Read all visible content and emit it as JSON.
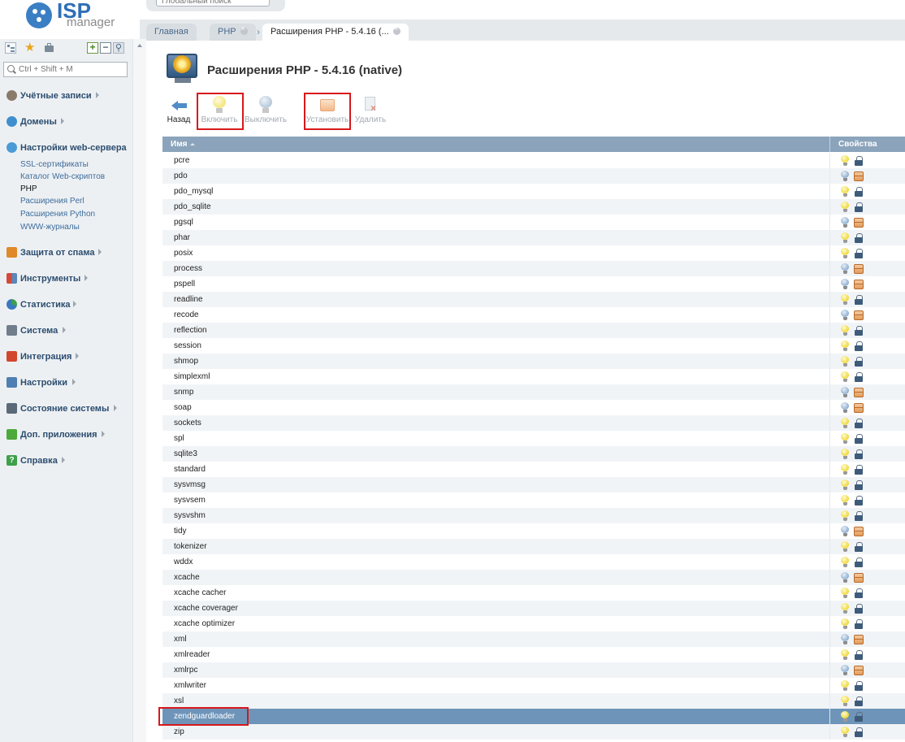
{
  "header": {
    "logo_brand": "ISP",
    "logo_sub": "manager",
    "global_search_placeholder": "Глобальный поиск"
  },
  "tabs": [
    {
      "label": "Главная"
    },
    {
      "label": "PHP"
    },
    {
      "label": "Расширения PHP - 5.4.16 (..."
    }
  ],
  "sidebar": {
    "search_placeholder": "Ctrl + Shift + M",
    "sections": [
      {
        "label": "Учётные записи"
      },
      {
        "label": "Домены"
      },
      {
        "label": "Настройки web-сервера"
      },
      {
        "label": "Защита от спама"
      },
      {
        "label": "Инструменты"
      },
      {
        "label": "Статистика"
      },
      {
        "label": "Система"
      },
      {
        "label": "Интеграция"
      },
      {
        "label": "Настройки"
      },
      {
        "label": "Состояние системы"
      },
      {
        "label": "Доп. приложения"
      },
      {
        "label": "Справка"
      }
    ],
    "web_server_items": [
      {
        "label": "SSL-сертификаты"
      },
      {
        "label": "Каталог Web-скриптов"
      },
      {
        "label": "PHP"
      },
      {
        "label": "Расширения Perl"
      },
      {
        "label": "Расширения Python"
      },
      {
        "label": "WWW-журналы"
      }
    ]
  },
  "page": {
    "title": "Расширения PHP - 5.4.16 (native)"
  },
  "toolbar": {
    "back": "Назад",
    "enable": "Включить",
    "disable": "Выключить",
    "install": "Установить",
    "delete": "Удалить"
  },
  "table": {
    "col_name": "Имя",
    "col_props": "Свойства",
    "rows": [
      {
        "name": "pcre",
        "status": "on",
        "type": "builtin"
      },
      {
        "name": "pdo",
        "status": "off",
        "type": "package"
      },
      {
        "name": "pdo_mysql",
        "status": "on",
        "type": "builtin"
      },
      {
        "name": "pdo_sqlite",
        "status": "on",
        "type": "builtin"
      },
      {
        "name": "pgsql",
        "status": "off",
        "type": "package"
      },
      {
        "name": "phar",
        "status": "on",
        "type": "builtin"
      },
      {
        "name": "posix",
        "status": "on",
        "type": "builtin"
      },
      {
        "name": "process",
        "status": "off",
        "type": "package"
      },
      {
        "name": "pspell",
        "status": "off",
        "type": "package"
      },
      {
        "name": "readline",
        "status": "on",
        "type": "builtin"
      },
      {
        "name": "recode",
        "status": "off",
        "type": "package"
      },
      {
        "name": "reflection",
        "status": "on",
        "type": "builtin"
      },
      {
        "name": "session",
        "status": "on",
        "type": "builtin"
      },
      {
        "name": "shmop",
        "status": "on",
        "type": "builtin"
      },
      {
        "name": "simplexml",
        "status": "on",
        "type": "builtin"
      },
      {
        "name": "snmp",
        "status": "off",
        "type": "package"
      },
      {
        "name": "soap",
        "status": "off",
        "type": "package"
      },
      {
        "name": "sockets",
        "status": "on",
        "type": "builtin"
      },
      {
        "name": "spl",
        "status": "on",
        "type": "builtin"
      },
      {
        "name": "sqlite3",
        "status": "on",
        "type": "builtin"
      },
      {
        "name": "standard",
        "status": "on",
        "type": "builtin"
      },
      {
        "name": "sysvmsg",
        "status": "on",
        "type": "builtin"
      },
      {
        "name": "sysvsem",
        "status": "on",
        "type": "builtin"
      },
      {
        "name": "sysvshm",
        "status": "on",
        "type": "builtin"
      },
      {
        "name": "tidy",
        "status": "off",
        "type": "package"
      },
      {
        "name": "tokenizer",
        "status": "on",
        "type": "builtin"
      },
      {
        "name": "wddx",
        "status": "on",
        "type": "builtin"
      },
      {
        "name": "xcache",
        "status": "off",
        "type": "package"
      },
      {
        "name": "xcache cacher",
        "status": "on",
        "type": "builtin"
      },
      {
        "name": "xcache coverager",
        "status": "on",
        "type": "builtin"
      },
      {
        "name": "xcache optimizer",
        "status": "on",
        "type": "builtin"
      },
      {
        "name": "xml",
        "status": "off",
        "type": "package"
      },
      {
        "name": "xmlreader",
        "status": "on",
        "type": "builtin"
      },
      {
        "name": "xmlrpc",
        "status": "off",
        "type": "package"
      },
      {
        "name": "xmlwriter",
        "status": "on",
        "type": "builtin"
      },
      {
        "name": "xsl",
        "status": "on",
        "type": "builtin"
      },
      {
        "name": "zendguardloader",
        "status": "on",
        "type": "builtin",
        "selected": true
      },
      {
        "name": "zip",
        "status": "on",
        "type": "builtin"
      }
    ]
  },
  "colors": {
    "header_bg": "#8ba4bc",
    "selected_row": "#6e95b9",
    "highlight_box": "#d8181c",
    "link": "#3d6d9c"
  }
}
